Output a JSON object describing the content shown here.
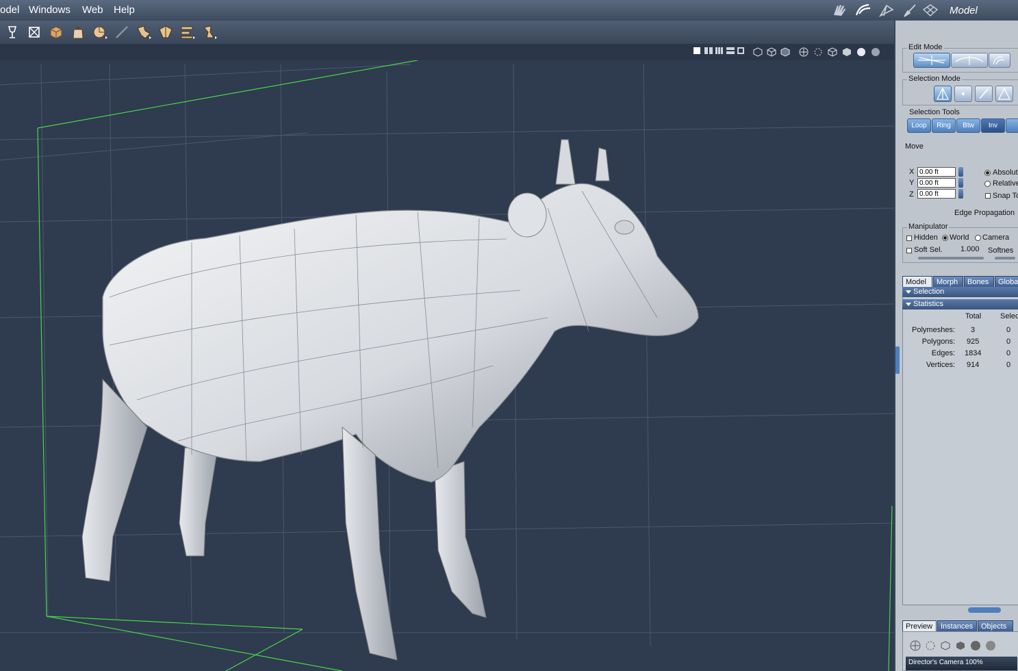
{
  "menubar": {
    "items": [
      "odel",
      "Windows",
      "Web",
      "Help"
    ],
    "room_label": "Model"
  },
  "right_panel": {
    "edit_mode": {
      "title": "Edit Mode"
    },
    "selection_mode": {
      "title": "Selection Mode"
    },
    "selection_tools": {
      "title": "Selection Tools",
      "buttons": [
        "Loop",
        "Ring",
        "Btw",
        "Inv"
      ]
    },
    "move": {
      "title": "Move",
      "x_label": "X",
      "y_label": "Y",
      "z_label": "Z",
      "x_value": "0.00 ft",
      "y_value": "0.00 ft",
      "z_value": "0.00 ft",
      "absolute": "Absolut",
      "relative": "Relative",
      "snap": "Snap Tc",
      "edge_propagation": "Edge Propagation"
    },
    "manipulator": {
      "title": "Manipulator",
      "hidden": "Hidden",
      "world": "World",
      "camera": "Camera",
      "soft_sel": "Soft Sel.",
      "soft_value": "1.000",
      "softness": "Softnes"
    },
    "tabs": [
      "Model",
      "Morph",
      "Bones",
      "Global"
    ],
    "sections": {
      "selection": "Selection",
      "statistics": "Statistics"
    },
    "stats": {
      "header_total": "Total",
      "header_selected": "Selecte",
      "rows": [
        {
          "label": "Polymeshes:",
          "total": "3",
          "selected": "0"
        },
        {
          "label": "Polygons:",
          "total": "925",
          "selected": "0"
        },
        {
          "label": "Edges:",
          "total": "1834",
          "selected": "0"
        },
        {
          "label": "Vertices:",
          "total": "914",
          "selected": "0"
        }
      ]
    },
    "bottom_tabs": [
      "Preview",
      "Instances",
      "Objects"
    ],
    "camera_label": "Director's Camera 100%"
  },
  "colors": {
    "viewport_bg": "#2f3b4e",
    "grid": "#4a5871",
    "bbox": "#49d64a",
    "panel_bg": "#bfc5cd",
    "accent_blue": "#4e7fbd"
  }
}
